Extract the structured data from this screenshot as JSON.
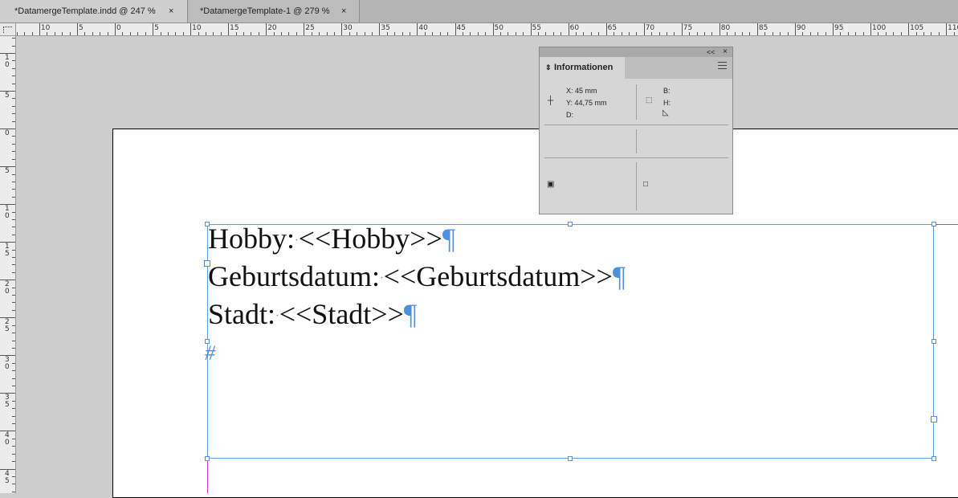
{
  "tabs": [
    {
      "title": "*DatamergeTemplate.indd @ 247 %",
      "close": "×"
    },
    {
      "title": "*DatamergeTemplate-1 @ 279 %",
      "close": "×"
    }
  ],
  "ruler": {
    "horizontal_labels": [
      "10",
      "5",
      "0",
      "5",
      "10",
      "15",
      "20",
      "25",
      "30",
      "35",
      "40",
      "45",
      "50",
      "55",
      "60",
      "65",
      "70",
      "75",
      "80",
      "85",
      "90",
      "95",
      "100",
      "105",
      "110"
    ],
    "vertical_labels": [
      "10",
      "5",
      "0",
      "5",
      "10",
      "15",
      "20",
      "25",
      "30",
      "35",
      "40",
      "45"
    ]
  },
  "text_frame": {
    "lines": [
      {
        "label": "Hobby:",
        "field": "<<Hobby>>"
      },
      {
        "label": "Geburtsdatum:",
        "field": "<<Geburtsdatum>>"
      },
      {
        "label": "Stadt:",
        "field": "<<Stadt>>"
      }
    ],
    "pilcrow": "¶",
    "space_marker": "·",
    "end_marker": "#"
  },
  "info_panel": {
    "title": "Informationen",
    "collapse": "<<",
    "close": "×",
    "x": "X: 45 mm",
    "y": "Y: 44,75 mm",
    "d": "D:",
    "b": "B:",
    "h": "H:",
    "icons": [
      "crosshair-icon",
      "bounds-icon",
      "angle-icon",
      "fill-icon",
      "stroke-icon"
    ]
  },
  "colors": {
    "guide": "#4e8fe0",
    "frame": "#6a9fd8",
    "margin": "#c33ccd"
  }
}
